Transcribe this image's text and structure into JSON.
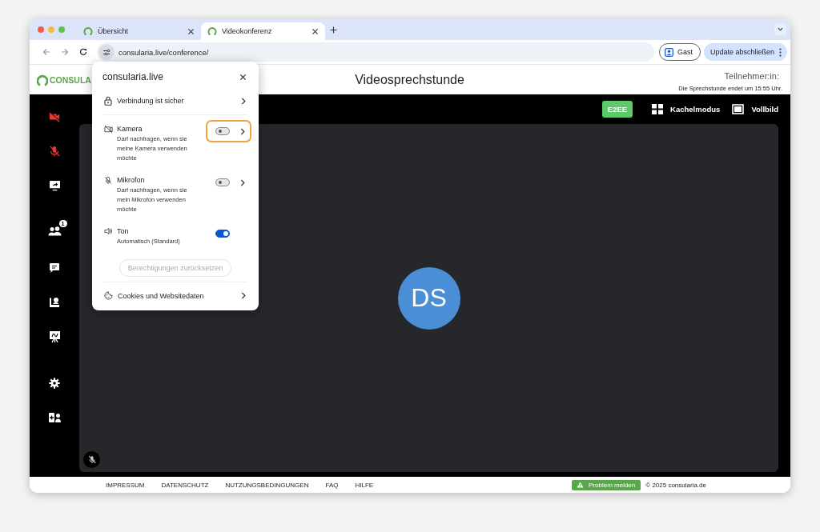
{
  "browser": {
    "tabs": [
      {
        "title": "Übersicht",
        "selected": false
      },
      {
        "title": "Videokonferenz",
        "selected": true
      }
    ],
    "url": {
      "host": "consularia.live",
      "path": "/conference/"
    },
    "profile_button": "Gast",
    "update_button": "Update abschließen"
  },
  "header": {
    "logo": "CONSULA",
    "title": "Videosprechstunde",
    "participants_label": "Teilnehmer:in:",
    "end_notice": "Die Sprechstunde endet um 15:55 Uhr."
  },
  "toolbar": {
    "encryption_badge": "E2EE",
    "tile_mode": "Kachelmodus",
    "fullscreen": "Vollbild"
  },
  "sidebar": {
    "camera_on": false,
    "microphone_on": false,
    "participants_badge": "1"
  },
  "video_tile": {
    "initials": "DS",
    "muted": true
  },
  "footer": {
    "links": [
      "IMPRESSUM",
      "DATENSCHUTZ",
      "NUTZUNGSBEDINGUNGEN",
      "FAQ",
      "HILFE"
    ],
    "problem_button": "Problem melden",
    "copyright": "© 2025 consularia.de"
  },
  "site_info_popup": {
    "title": "consularia.live",
    "connection": "Verbindung ist sicher",
    "permissions": [
      {
        "kind": "camera",
        "label": "Kamera",
        "description": "Darf nachfragen, wenn sie meine Kamera verwenden möchte",
        "on": false,
        "highlighted": true
      },
      {
        "kind": "microphone",
        "label": "Mikrofon",
        "description": "Darf nachfragen, wenn sie mein Mikrofon verwenden möchte",
        "on": false,
        "highlighted": false
      },
      {
        "kind": "sound",
        "label": "Ton",
        "description": "Automatisch (Standard)",
        "on": true,
        "highlighted": false
      }
    ],
    "reset_button": {
      "label": "Berechtigungen zurücksetzen",
      "disabled": true
    },
    "cookies": "Cookies und Websitedaten"
  }
}
